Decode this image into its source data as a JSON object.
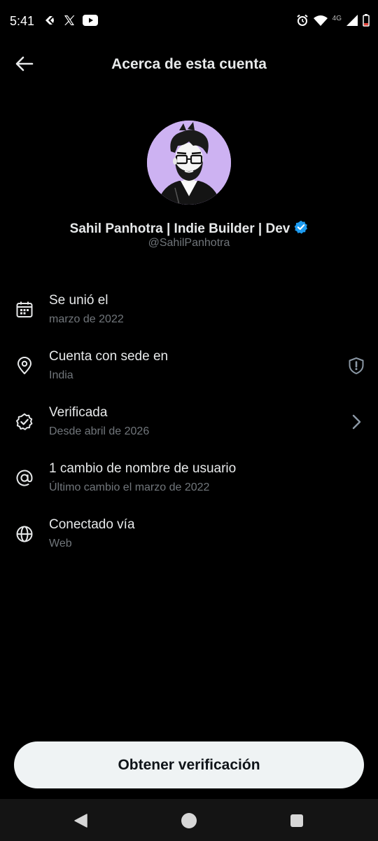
{
  "status_bar": {
    "time": "5:41",
    "network": "4G",
    "left_icons": [
      "sync-app-icon",
      "x-logo-icon",
      "youtube-icon"
    ],
    "right_icons": [
      "alarm-icon",
      "wifi-icon",
      "signal-icon",
      "battery-icon"
    ]
  },
  "header": {
    "title": "Acerca de esta cuenta",
    "back_icon": "arrow-left-icon"
  },
  "profile": {
    "display_name": "Sahil Panhotra | Indie Builder | Dev",
    "handle": "@SahilPanhotra",
    "verified_badge_color": "#1d9bf0",
    "avatar_bg": "#cdb2f2"
  },
  "info_items": [
    {
      "icon": "calendar-icon",
      "title": "Se unió el",
      "subtitle": "marzo de 2022"
    },
    {
      "icon": "location-pin-icon",
      "title": "Cuenta con sede en",
      "subtitle": "India",
      "trailing_icon": "shield-alert-icon"
    },
    {
      "icon": "verified-check-icon",
      "title": "Verificada",
      "subtitle": "Desde abril de 2026",
      "trailing_icon": "chevron-right-icon"
    },
    {
      "icon": "at-sign-icon",
      "title": "1 cambio de nombre de usuario",
      "subtitle": "Último cambio el marzo de 2022"
    },
    {
      "icon": "globe-icon",
      "title": "Conectado vía",
      "subtitle": "Web"
    }
  ],
  "cta": {
    "label": "Obtener verificación"
  },
  "nav_bar": {
    "buttons": [
      "back-triangle-icon",
      "home-circle-icon",
      "recents-square-icon"
    ]
  },
  "colors": {
    "background": "#000000",
    "primary_text": "#e7e9ea",
    "secondary_text": "#71767b",
    "button_bg": "#eff3f4",
    "button_text": "#0f1419",
    "nav_bar_bg": "#141414"
  }
}
